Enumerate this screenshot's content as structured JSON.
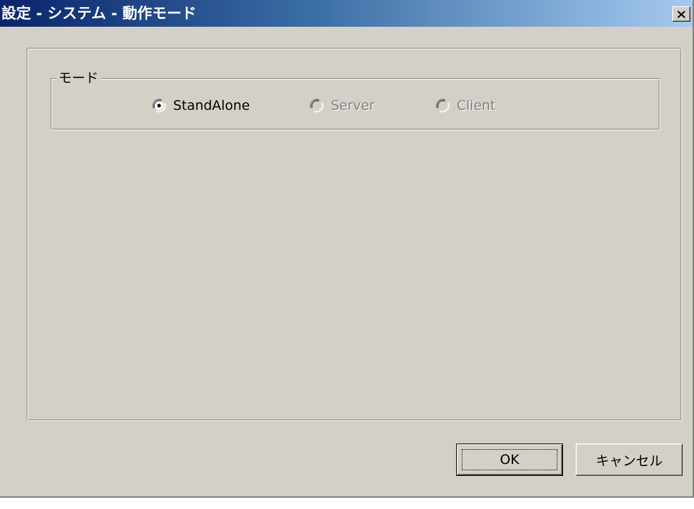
{
  "window": {
    "title": "設定 - システム - 動作モード",
    "close_label": "×"
  },
  "mode_group": {
    "label": "モード",
    "options": [
      {
        "label": "StandAlone",
        "selected": true,
        "enabled": true
      },
      {
        "label": "Server",
        "selected": false,
        "enabled": false
      },
      {
        "label": "Client",
        "selected": false,
        "enabled": false
      }
    ]
  },
  "buttons": {
    "ok_label": "OK",
    "cancel_label": "キャンセル"
  },
  "colors": {
    "face": "#d4d0c8",
    "title_start": "#0a246a",
    "title_end": "#a6caf0",
    "disabled_text": "#808080"
  }
}
